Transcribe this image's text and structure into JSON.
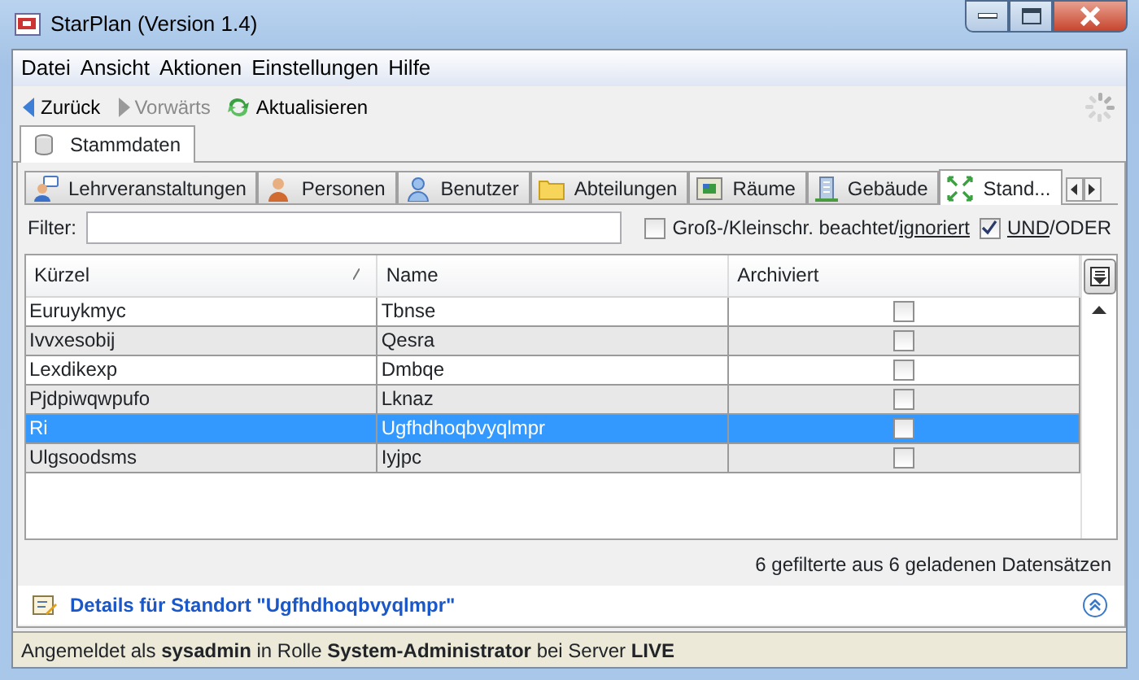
{
  "window": {
    "title": "StarPlan (Version 1.4)"
  },
  "menu": [
    "Datei",
    "Ansicht",
    "Aktionen",
    "Einstellungen",
    "Hilfe"
  ],
  "toolbar": [
    {
      "label": "Zurück",
      "kind": "back",
      "disabled": false
    },
    {
      "label": "Vorwärts",
      "kind": "forward",
      "disabled": true
    },
    {
      "label": "Aktualisieren",
      "kind": "refresh",
      "disabled": false
    }
  ],
  "outer_tabs": [
    {
      "label": "Stammdaten",
      "selected": true
    }
  ],
  "inner_tabs": [
    {
      "label": "Lehrveranstaltungen",
      "kind": "course",
      "selected": false
    },
    {
      "label": "Personen",
      "kind": "person",
      "selected": false
    },
    {
      "label": "Benutzer",
      "kind": "user",
      "selected": false
    },
    {
      "label": "Abteilungen",
      "kind": "folder",
      "selected": false
    },
    {
      "label": "Räume",
      "kind": "room",
      "selected": false
    },
    {
      "label": "Gebäude",
      "kind": "building",
      "selected": false
    },
    {
      "label": "Stand...",
      "kind": "location",
      "selected": true
    }
  ],
  "filter": {
    "label": "Filter:"
  },
  "options": [
    {
      "checked": false,
      "parts": [
        {
          "text": "Groß-/Kleinschr. beachtet/",
          "underlined": false
        },
        {
          "text": "ignoriert",
          "underlined": true
        }
      ]
    },
    {
      "checked": true,
      "parts": [
        {
          "text": "UND",
          "underlined": true
        },
        {
          "text": "/ODER",
          "underlined": false
        }
      ]
    }
  ],
  "table": {
    "columns": [
      "Kürzel",
      "Name",
      "Archiviert"
    ],
    "rows": [
      {
        "cells": [
          "Euruykmyc",
          "Tbnse"
        ],
        "archived": false,
        "selected": false
      },
      {
        "cells": [
          "Ivvxesobij",
          "Qesra"
        ],
        "archived": false,
        "selected": false
      },
      {
        "cells": [
          "Lexdikexp",
          "Dmbqe"
        ],
        "archived": false,
        "selected": false
      },
      {
        "cells": [
          "Pjdpiwqwpufo",
          "Lknaz"
        ],
        "archived": false,
        "selected": false
      },
      {
        "cells": [
          "Ri",
          "Ugfhdhoqbvyqlmpr"
        ],
        "archived": false,
        "selected": true
      },
      {
        "cells": [
          "Ulgsoodsms",
          "Iyjpc"
        ],
        "archived": false,
        "selected": false
      }
    ]
  },
  "record_count": "6 gefilterte aus 6 geladenen Datensätzen",
  "details": {
    "title": "Details für Standort \"Ugfhdhoqbvyqlmpr\""
  },
  "status_bar": "Angemeldet als **sysadmin** in Rolle **System-Administrator** bei Server **LIVE**"
}
